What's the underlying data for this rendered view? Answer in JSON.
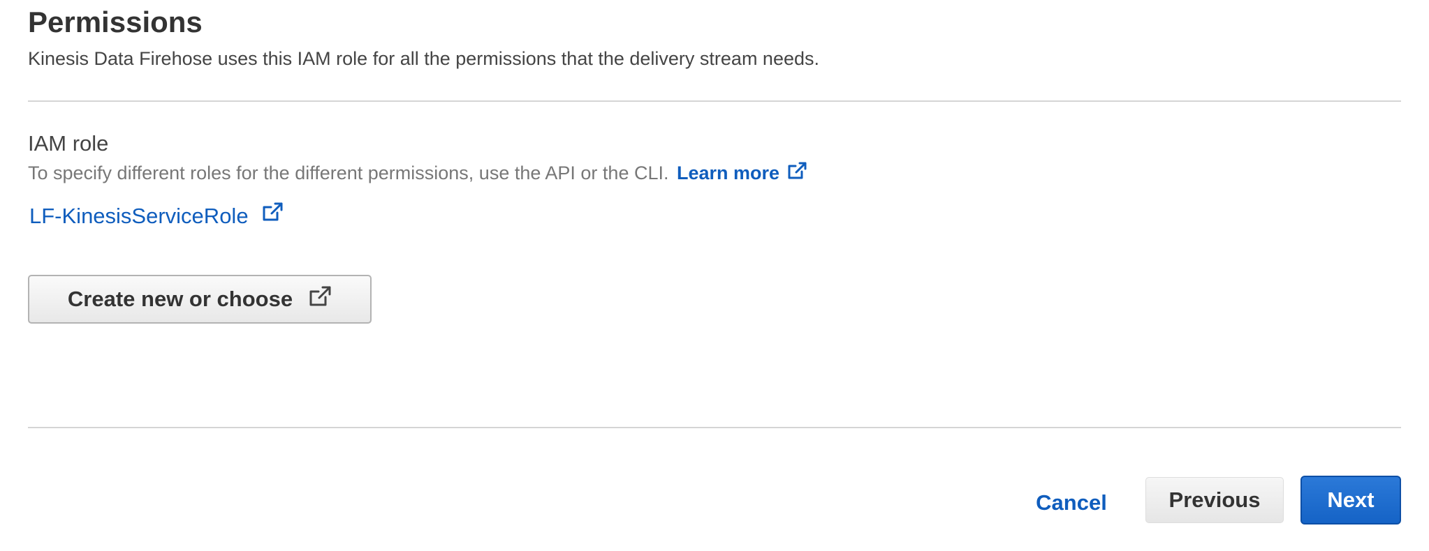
{
  "header": {
    "title": "Permissions",
    "subtitle": "Kinesis Data Firehose uses this IAM role for all the permissions that the delivery stream needs."
  },
  "iam_role": {
    "label": "IAM role",
    "description": "To specify different roles for the different permissions, use the API or the CLI.",
    "learn_more_label": "Learn more",
    "role_name": "LF-KinesisServiceRole",
    "create_button_label": "Create new or choose"
  },
  "footer": {
    "cancel_label": "Cancel",
    "previous_label": "Previous",
    "next_label": "Next"
  },
  "icons": {
    "external_link": "external-link-icon"
  },
  "colors": {
    "link": "#0f5dbd",
    "primary_button": "#1f6fd0",
    "text": "#333333",
    "muted_text": "#777777",
    "divider": "#d5d5d5"
  }
}
